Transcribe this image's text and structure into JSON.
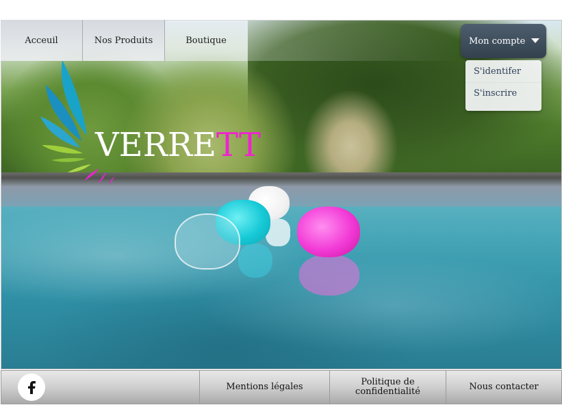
{
  "nav": {
    "items": [
      {
        "label": "Acceuil"
      },
      {
        "label": "Nos Produits"
      },
      {
        "label": "Boutique"
      }
    ]
  },
  "account": {
    "button_label": "Mon compte",
    "menu": [
      {
        "label": "S'identifer"
      },
      {
        "label": "S'inscrire"
      }
    ]
  },
  "logo": {
    "text_main": "VERRE",
    "text_accent": "TT",
    "accent_color": "#ef22cf"
  },
  "footer": {
    "social_icon": "facebook-icon",
    "links": [
      {
        "label": "Mentions légales"
      },
      {
        "label": "Politique de confidentialité"
      },
      {
        "label": "Nous contacter"
      }
    ]
  },
  "colors": {
    "account_bg": "#3f4e5c",
    "dropdown_text": "#2c3e55"
  }
}
